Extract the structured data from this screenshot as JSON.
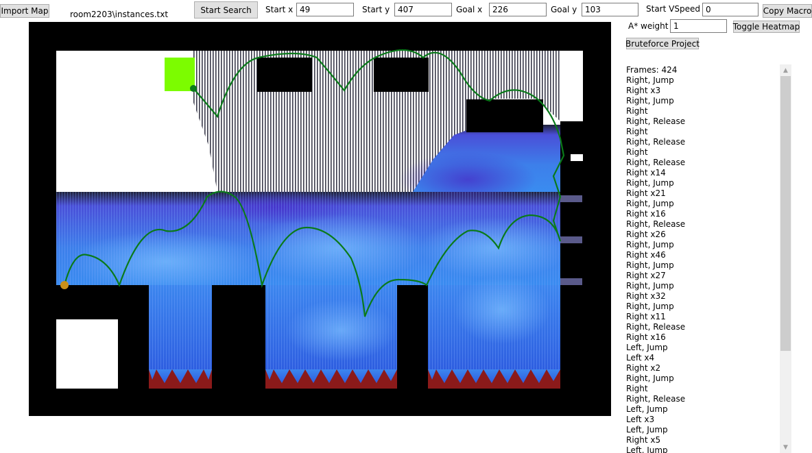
{
  "toolbar": {
    "import_map": "Import Map",
    "file_path": "room2203\\instances.txt",
    "start_search": "Start Search",
    "start_x_label": "Start x",
    "start_x_value": "49",
    "start_y_label": "Start y",
    "start_y_value": "407",
    "goal_x_label": "Goal x",
    "goal_x_value": "226",
    "goal_y_label": "Goal y",
    "goal_y_value": "103",
    "start_vspeed_label": "Start VSpeed",
    "start_vspeed_value": "0",
    "copy_macro": "Copy Macro",
    "astar_weight_label": "A* weight",
    "astar_weight_value": "1",
    "toggle_heatmap": "Toggle Heatmap",
    "bruteforce_project": "Bruteforce Project"
  },
  "colors": {
    "wall": "#000000",
    "floor": "#ffffff",
    "goal": "#7cfc00",
    "path": "#0a7a1a",
    "start_marker": "#c8901a",
    "spikes": "#8b1a1a",
    "heat_low": "#3a3fd6",
    "heat_high": "#5aa8f0"
  },
  "macro": {
    "frames_label": "Frames: 424",
    "lines": [
      "Right, Jump",
      "Right x3",
      "Right, Jump",
      "Right",
      "Right, Release",
      "Right",
      "Right, Release",
      "Right",
      "Right, Release",
      "Right x14",
      "Right, Jump",
      "Right x21",
      "Right, Jump",
      "Right x16",
      "Right, Release",
      "Right x26",
      "Right, Jump",
      "Right x46",
      "Right, Jump",
      "Right x27",
      "Right, Jump",
      "Right x32",
      "Right, Jump",
      "Right x11",
      "Right, Release",
      "Right x16",
      "Left, Jump",
      "Left x4",
      "Right x2",
      "Right, Jump",
      "Right",
      "Right, Release",
      "Left, Jump",
      "Left x3",
      "Left, Jump",
      "Right x5",
      "Left, Jump"
    ]
  }
}
